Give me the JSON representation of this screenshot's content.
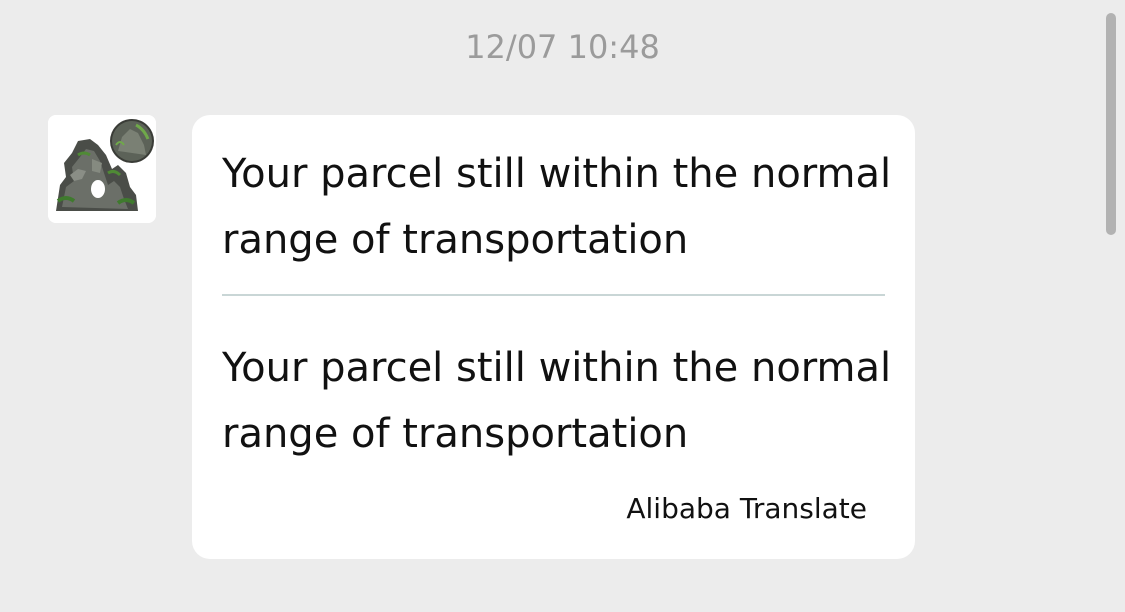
{
  "chat": {
    "timestamp": "12/07 10:48",
    "message": {
      "avatar_icon": "aquarium-rock-decoration-photo",
      "original_text": "Your parcel still within the normal range of transportation",
      "translated_text": "Your parcel still within the normal range of transportation",
      "translation_credit": "Alibaba Translate"
    }
  },
  "colors": {
    "background": "#ececec",
    "bubble": "#ffffff",
    "timestamp_text": "#9b9b9b",
    "divider": "#c9d6d6"
  }
}
